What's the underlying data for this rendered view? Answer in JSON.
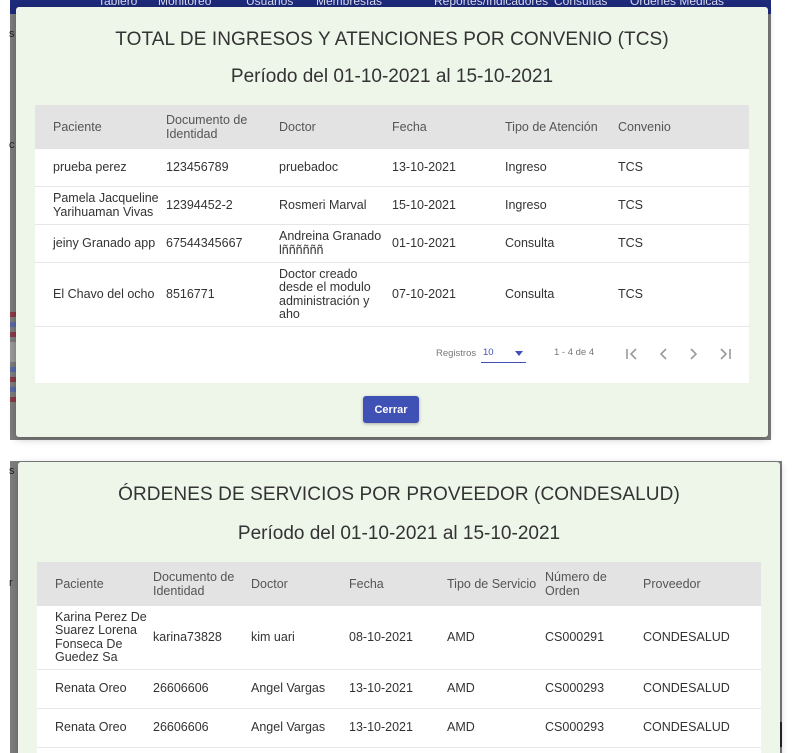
{
  "nav": {
    "items": [
      "Tablero",
      "Monitoreo",
      "Usuarios",
      "Membresías",
      "Reportes/Indicadores",
      "Consultas",
      "Órdenes Médicas"
    ]
  },
  "background_letters": [
    "s",
    "c",
    "s",
    "r"
  ],
  "colors": {
    "primary": "#3f51b5",
    "navbar": "#1e2a7a",
    "dialog_bg": "#eef5e9",
    "header_bg": "#e3e3e3"
  },
  "dialog1": {
    "title": "TOTAL DE INGRESOS Y ATENCIONES POR CONVENIO (TCS)",
    "period": "Período del 01-10-2021 al 15-10-2021",
    "columns": [
      "Paciente",
      "Documento de Identidad",
      "Doctor",
      "Fecha",
      "Tipo de Atención",
      "Convenio"
    ],
    "rows": [
      [
        "prueba perez",
        "123456789",
        "pruebadoc",
        "13-10-2021",
        "Ingreso",
        "TCS"
      ],
      [
        "Pamela Jacqueline Yarihuaman Vivas",
        "12394452-2",
        "Rosmeri Marval",
        "15-10-2021",
        "Ingreso",
        "TCS"
      ],
      [
        "jeiny Granado app",
        "67544345667",
        "Andreina Granado lññññññ",
        "01-10-2021",
        "Consulta",
        "TCS"
      ],
      [
        "El Chavo del ocho",
        "8516771",
        "Doctor creado desde el modulo administración y aho",
        "07-10-2021",
        "Consulta",
        "TCS"
      ]
    ],
    "paginator": {
      "label": "Registros",
      "page_size": "10",
      "range": "1 - 4 de 4"
    },
    "pager_icons": [
      "first-page-icon",
      "previous-page-icon",
      "next-page-icon",
      "last-page-icon"
    ],
    "close_label": "Cerrar"
  },
  "dialog2": {
    "title": "ÓRDENES DE SERVICIOS POR PROVEEDOR (CONDESALUD)",
    "period": "Período del 01-10-2021 al 15-10-2021",
    "columns": [
      "Paciente",
      "Documento de Identidad",
      "Doctor",
      "Fecha",
      "Tipo de Servicio",
      "Número de Orden",
      "Proveedor"
    ],
    "rows": [
      [
        "Karina Perez De Suarez Lorena Fonseca De Guedez Sa",
        "karina73828",
        "kim uari",
        "08-10-2021",
        "AMD",
        "CS000291",
        "CONDESALUD"
      ],
      [
        "Renata Oreo",
        "26606606",
        "Angel Vargas",
        "13-10-2021",
        "AMD",
        "CS000293",
        "CONDESALUD"
      ],
      [
        "Renata Oreo",
        "26606606",
        "Angel Vargas",
        "13-10-2021",
        "AMD",
        "CS000293",
        "CONDESALUD"
      ]
    ]
  }
}
